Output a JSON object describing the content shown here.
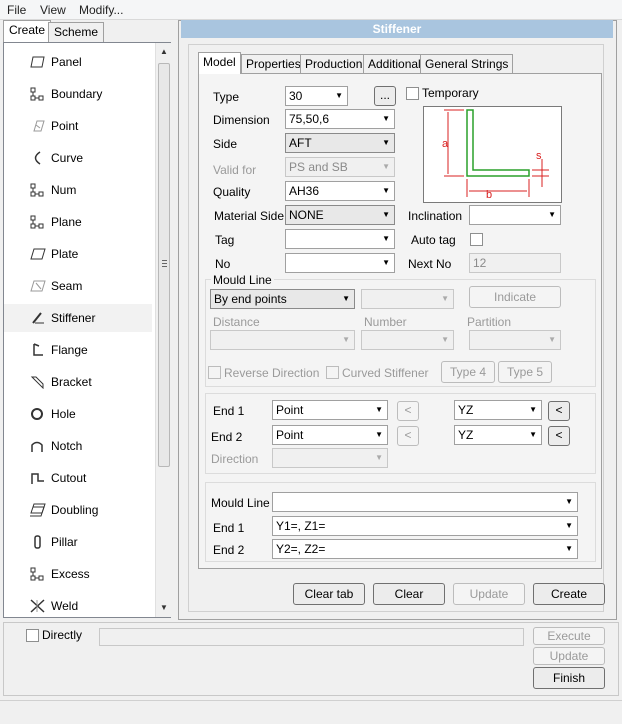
{
  "menu": [
    "File",
    "View",
    "Modify..."
  ],
  "left_tabs": [
    "Create",
    "Scheme"
  ],
  "left_items": [
    {
      "label": "Panel",
      "icon": "panel-icon"
    },
    {
      "label": "Boundary",
      "icon": "boundary-icon"
    },
    {
      "label": "Point",
      "icon": "point-icon"
    },
    {
      "label": "Curve",
      "icon": "curve-icon"
    },
    {
      "label": "Num",
      "icon": "num-icon"
    },
    {
      "label": "Plane",
      "icon": "plane-icon"
    },
    {
      "label": "Plate",
      "icon": "plate-icon"
    },
    {
      "label": "Seam",
      "icon": "seam-icon"
    },
    {
      "label": "Stiffener",
      "icon": "stiffener-icon"
    },
    {
      "label": "Flange",
      "icon": "flange-icon"
    },
    {
      "label": "Bracket",
      "icon": "bracket-icon"
    },
    {
      "label": "Hole",
      "icon": "hole-icon"
    },
    {
      "label": "Notch",
      "icon": "notch-icon"
    },
    {
      "label": "Cutout",
      "icon": "cutout-icon"
    },
    {
      "label": "Doubling",
      "icon": "doubling-icon"
    },
    {
      "label": "Pillar",
      "icon": "pillar-icon"
    },
    {
      "label": "Excess",
      "icon": "excess-icon"
    },
    {
      "label": "Weld",
      "icon": "weld-icon"
    }
  ],
  "dialog": {
    "title": "Stiffener",
    "tabs": [
      "Model",
      "Properties",
      "Production",
      "Additional",
      "General Strings"
    ],
    "type": {
      "label": "Type",
      "value": "30",
      "browse": "..."
    },
    "temporary": "Temporary",
    "dimension": {
      "label": "Dimension",
      "value": "75,50,6"
    },
    "side": {
      "label": "Side",
      "value": "AFT"
    },
    "valid_for": {
      "label": "Valid for",
      "value": "PS and SB"
    },
    "quality": {
      "label": "Quality",
      "value": "AH36"
    },
    "material_side": {
      "label": "Material Side",
      "value": "NONE"
    },
    "inclination": {
      "label": "Inclination",
      "value": ""
    },
    "tag": {
      "label": "Tag",
      "value": ""
    },
    "auto_tag": "Auto tag",
    "no": {
      "label": "No",
      "value": ""
    },
    "next_no": {
      "label": "Next No",
      "value": "12"
    },
    "diagram_labels": {
      "a": "a",
      "b": "b",
      "s": "s"
    },
    "mould_line_group": {
      "title": "Mould Line",
      "method": "By end points",
      "method2": "",
      "indicate": "Indicate",
      "distance": "Distance",
      "number": "Number",
      "partition": "Partition",
      "reverse": "Reverse Direction",
      "curved": "Curved Stiffener",
      "type4": "Type 4",
      "type5": "Type 5"
    },
    "ends": {
      "end1": {
        "label": "End 1",
        "value": "Point",
        "plane": "YZ",
        "lt": "<",
        "lt2": "<"
      },
      "end2": {
        "label": "End 2",
        "value": "Point",
        "plane": "YZ",
        "lt": "<",
        "lt2": "<"
      },
      "direction": {
        "label": "Direction",
        "value": ""
      }
    },
    "mould": {
      "mould_line": {
        "label": "Mould Line",
        "value": ""
      },
      "end1": {
        "label": "End 1",
        "value": "Y1=, Z1="
      },
      "end2": {
        "label": "End 2",
        "value": "Y2=, Z2="
      }
    },
    "buttons": {
      "clear_tab": "Clear tab",
      "clear": "Clear",
      "update": "Update",
      "create": "Create"
    }
  },
  "bottom": {
    "directly": "Directly",
    "execute": "Execute",
    "update": "Update",
    "finish": "Finish"
  },
  "colors": {
    "title_bar": "#a9c5df",
    "diagram_red": "#d92020",
    "diagram_green": "#2aa02a"
  }
}
